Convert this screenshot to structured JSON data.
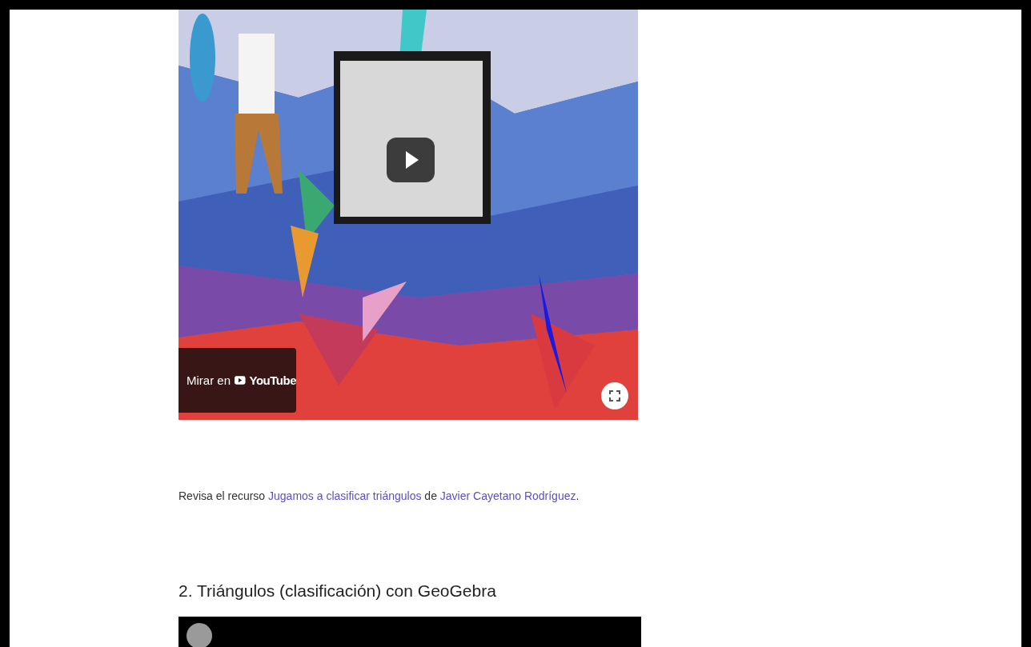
{
  "video_1": {
    "kind": "picture",
    "watch_on": {
      "label": "Mirar en",
      "platform": "YouTube"
    }
  },
  "paragraph": {
    "parts": [
      {
        "kind": "text",
        "text": "Revisa el recurso "
      },
      {
        "kind": "link",
        "text": "Jugamos a clasificar triángulos"
      },
      {
        "kind": "text",
        "text": " de "
      },
      {
        "kind": "link",
        "text": "Javier Cayetano Rodríguez"
      },
      {
        "kind": "text",
        "text": "."
      }
    ]
  },
  "heading": "2. Triángulos (clasificación) con GeoGebra",
  "video_2": {
    "kind": "player"
  }
}
